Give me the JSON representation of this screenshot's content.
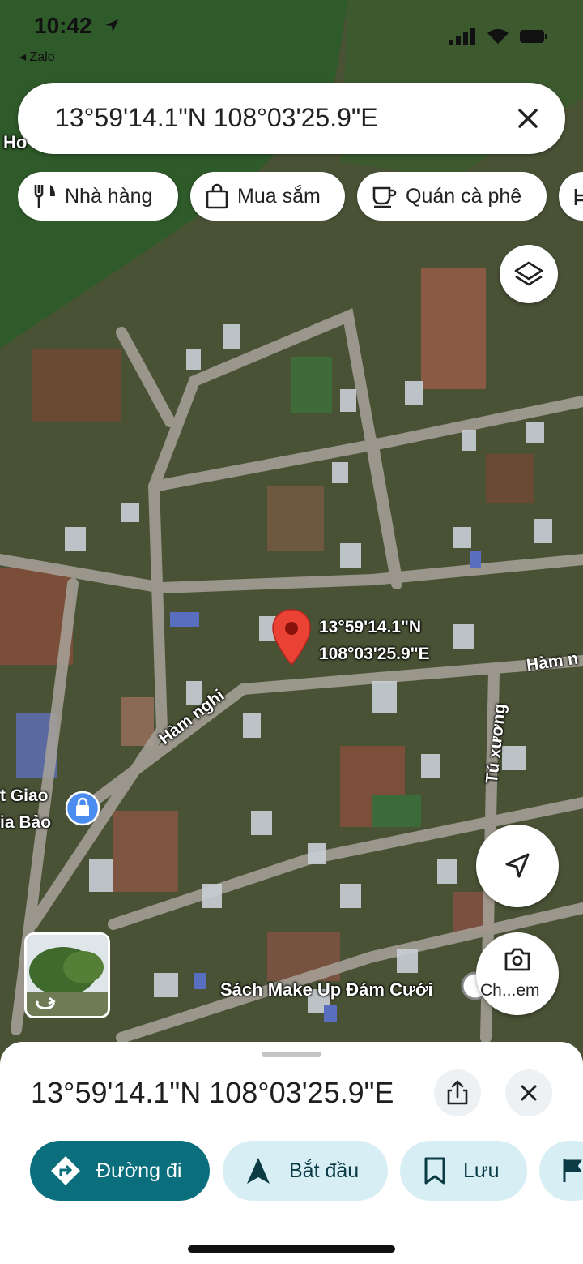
{
  "status_bar": {
    "time": "10:42",
    "back_app": "◂ Zalo"
  },
  "search": {
    "query": "13°59'14.1\"N 108°03'25.9\"E"
  },
  "chips": [
    {
      "label": "Nhà hàng",
      "icon": "restaurant-icon"
    },
    {
      "label": "Mua sắm",
      "icon": "shopping-bag-icon"
    },
    {
      "label": "Quán cà phê",
      "icon": "coffee-icon"
    }
  ],
  "map": {
    "pin_label_line1": "13°59'14.1\"N",
    "pin_label_line2": "108°03'25.9\"E",
    "place_labels": [
      "Hàm nghi",
      "Tú xương",
      "Hàm n",
      "t Giao",
      "ia Bảo",
      "Sách Make Up Đám Cưới",
      "Ho"
    ],
    "camera_label": "Ch...em"
  },
  "sheet": {
    "title": "13°59'14.1\"N 108°03'25.9\"E",
    "actions": [
      {
        "label": "Đường đi",
        "icon": "directions-icon"
      },
      {
        "label": "Bắt đầu",
        "icon": "navigation-arrow-icon"
      },
      {
        "label": "Lưu",
        "icon": "bookmark-icon"
      }
    ]
  },
  "colors": {
    "accent": "#0b6e7c",
    "tonal": "#d7eef5",
    "pin": "#ea4335"
  }
}
